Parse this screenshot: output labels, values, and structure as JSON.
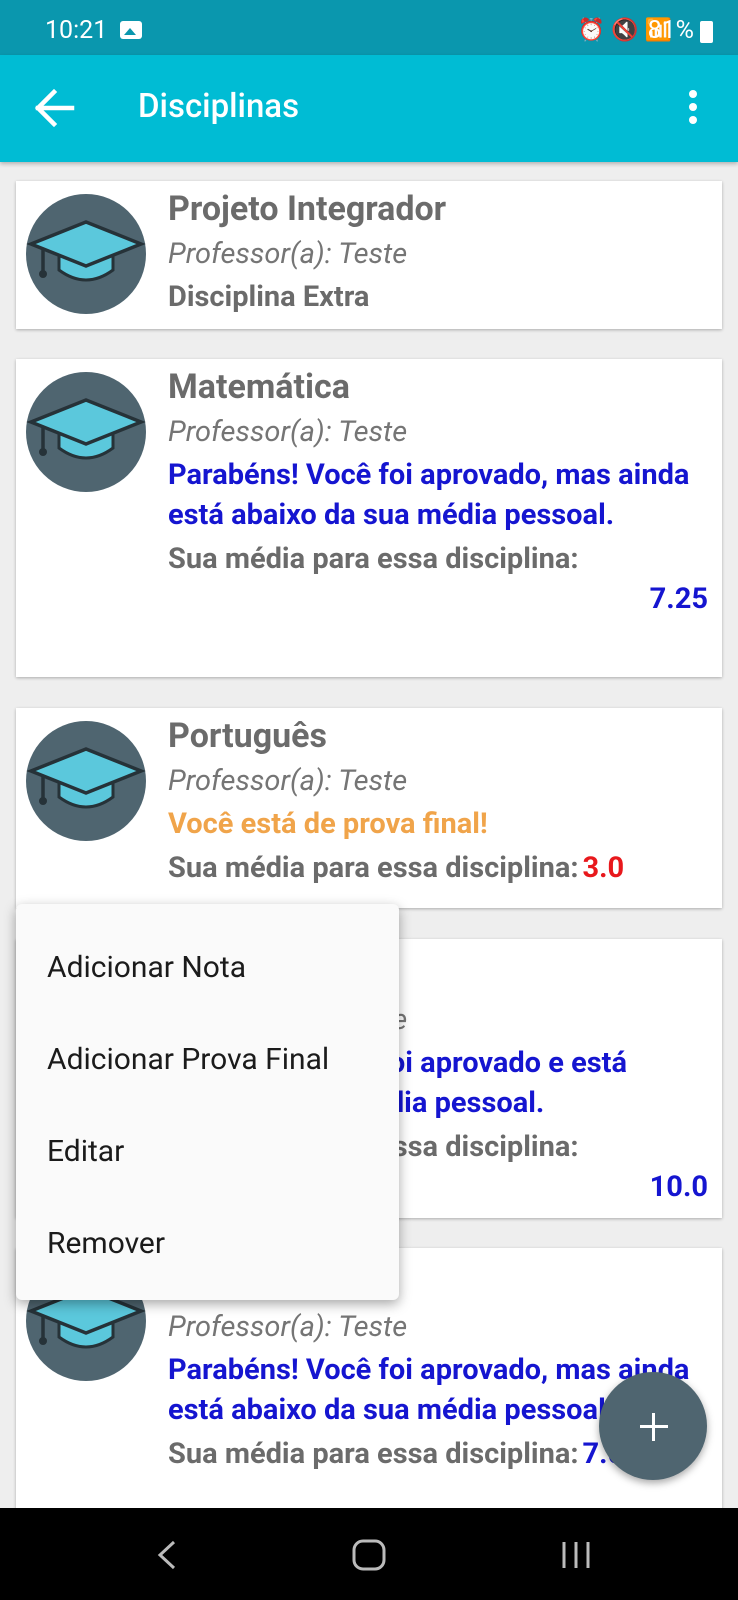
{
  "status_bar": {
    "time": "10:21",
    "icons": [
      "gallery-icon",
      "alarm-icon",
      "mute-icon",
      "wifi-icon",
      "signal-icon",
      "signal-icon"
    ],
    "battery": "81%"
  },
  "app_bar": {
    "title": "Disciplinas"
  },
  "subjects": [
    {
      "name": "Projeto Integrador",
      "professor": "Professor(a): Teste",
      "message": "Disciplina Extra"
    },
    {
      "name": "Matemática",
      "professor": "Professor(a): Teste",
      "message": "Parabéns! Você foi aprovado, mas ainda está abaixo da sua média pessoal.",
      "average_label": "Sua média para essa disciplina:",
      "average": "7.25"
    },
    {
      "name": "Português",
      "professor": "Professor(a): Teste",
      "message": "Você está de prova final!",
      "average_label": "Sua média para essa disciplina:",
      "average": "3.0"
    },
    {
      "professor": "Professor(a): Teste",
      "message": "Parabéns! Você foi aprovado e está acima da sua média pessoal.",
      "average_label": "Sua média para essa disciplina:",
      "average": "10.0"
    },
    {
      "professor": "Professor(a): Teste",
      "message": "Parabéns! Você foi aprovado, mas ainda está abaixo da sua média pessoal.",
      "average_label": "Sua média para essa disciplina:",
      "average": "7.0"
    }
  ],
  "context_menu": {
    "items": [
      "Adicionar Nota",
      "Adicionar Prova Final",
      "Editar",
      "Remover"
    ]
  },
  "fab": {
    "icon": "plus-icon"
  },
  "colors": {
    "app_bar": "#00bcd4",
    "status_bar": "#0a97ae",
    "approved_text": "#1515d0",
    "final_exam_text": "#f0a44a",
    "failing_average": "#e8181c",
    "fab": "#4f6570"
  }
}
